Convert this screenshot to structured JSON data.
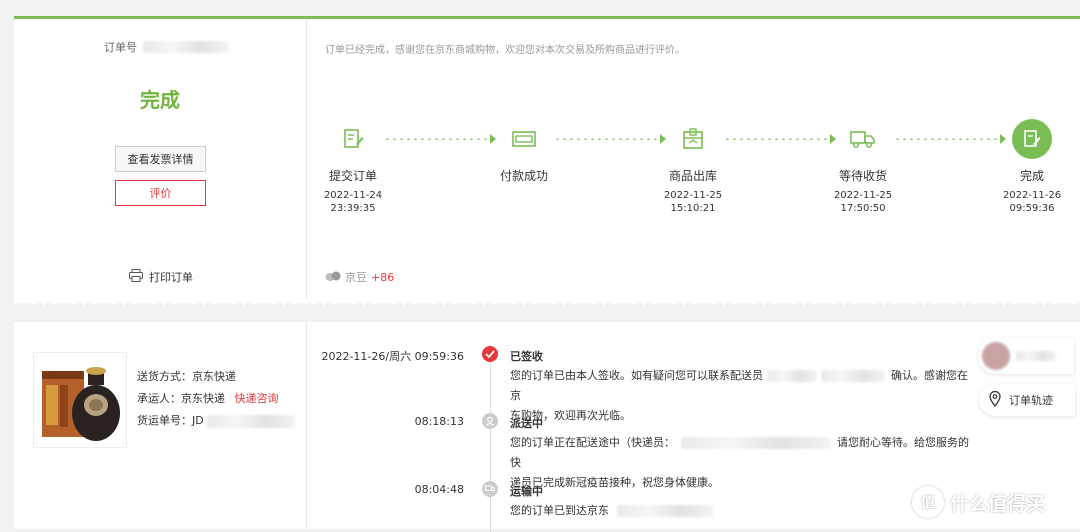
{
  "order": {
    "number_label": "订单号",
    "status": "完成",
    "invoice_button": "查看发票详情",
    "review_button": "评价",
    "print_label": "打印订单",
    "thanks_message": "订单已经完成，感谢您在京东商城购物，欢迎您对本次交易及所购商品进行评价。"
  },
  "progress": {
    "steps": [
      {
        "label": "提交订单",
        "date": "2022-11-24",
        "time": "23:39:35",
        "icon": "submit-order-icon"
      },
      {
        "label": "付款成功",
        "date": "",
        "time": "",
        "icon": "payment-card-icon"
      },
      {
        "label": "商品出库",
        "date": "2022-11-25",
        "time": "15:10:21",
        "icon": "warehouse-box-icon"
      },
      {
        "label": "等待收货",
        "date": "2022-11-25",
        "time": "17:50:50",
        "icon": "delivery-truck-icon"
      },
      {
        "label": "完成",
        "date": "2022-11-26",
        "time": "09:59:36",
        "icon": "complete-check-icon"
      }
    ]
  },
  "beans": {
    "label": "京豆",
    "amount": "+86"
  },
  "shipment": {
    "method_label": "送货方式：京东快递",
    "carrier_label": "承运人：京东快递",
    "carrier_link": "快递咨询",
    "waybill_label": "货运单号：JD"
  },
  "tracking": [
    {
      "time": "2022-11-26/周六   09:59:36",
      "title": "已签收",
      "body_a": "您的订单已由本人签收。如有疑问您可以联系配送员",
      "body_b": "确认。感谢您在京",
      "body_c": "东购物，欢迎再次光临。",
      "active": true
    },
    {
      "time": "08:18:13",
      "title": "派送中",
      "body_a": "您的订单正在配送途中（快递员：",
      "body_b": "请您耐心等待。给您服务的快",
      "body_c": "递员已完成新冠疫苗接种，祝您身体健康。",
      "active": false
    },
    {
      "time": "08:04:48",
      "title": "运输中",
      "body_a": "您的订单已到达京东",
      "body_b": "",
      "body_c": "",
      "active": false
    }
  ],
  "side": {
    "track_button": "订单轨迹"
  },
  "watermark": {
    "text": "什么值得买",
    "icon_glyph": "值"
  },
  "colors": {
    "green": "#7abd54",
    "red": "#e4393c"
  }
}
